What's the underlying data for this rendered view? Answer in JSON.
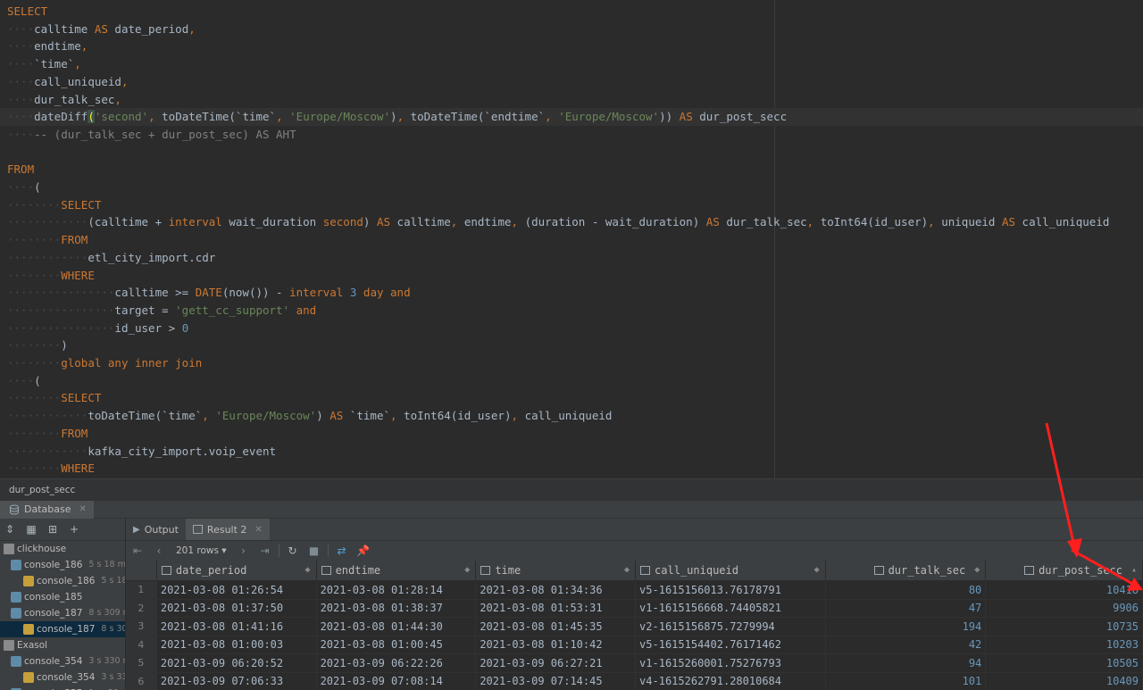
{
  "editor": {
    "lines": [
      [
        {
          "t": "SELECT",
          "c": "kw"
        }
      ],
      [
        {
          "t": "····",
          "c": "ws"
        },
        {
          "t": "calltime "
        },
        {
          "t": "AS",
          "c": "kw"
        },
        {
          "t": " date_period"
        },
        {
          "t": ",",
          "c": "kw"
        }
      ],
      [
        {
          "t": "····",
          "c": "ws"
        },
        {
          "t": "endtime"
        },
        {
          "t": ",",
          "c": "kw"
        }
      ],
      [
        {
          "t": "····",
          "c": "ws"
        },
        {
          "t": "`time`"
        },
        {
          "t": ",",
          "c": "kw"
        }
      ],
      [
        {
          "t": "····",
          "c": "ws"
        },
        {
          "t": "call_uniqueid"
        },
        {
          "t": ",",
          "c": "kw"
        }
      ],
      [
        {
          "t": "····",
          "c": "ws"
        },
        {
          "t": "dur_talk_sec"
        },
        {
          "t": ",",
          "c": "kw"
        }
      ],
      [
        {
          "t": "····",
          "c": "ws"
        },
        {
          "t": "dateDiff"
        },
        {
          "t": "(",
          "c": "br"
        },
        {
          "t": "'second'",
          "c": "str"
        },
        {
          "t": ", ",
          "c": "kw"
        },
        {
          "t": "toDateTime(`time`"
        },
        {
          "t": ", ",
          "c": "kw"
        },
        {
          "t": "'Europe/Moscow'",
          "c": "str"
        },
        {
          "t": ")"
        },
        {
          "t": ", ",
          "c": "kw"
        },
        {
          "t": "toDateTime(`endtime`"
        },
        {
          "t": ", ",
          "c": "kw"
        },
        {
          "t": "'Europe/Moscow'",
          "c": "str"
        },
        {
          "t": "))"
        },
        {
          "t": " AS",
          "c": "kw"
        },
        {
          "t": " dur_post_secc"
        }
      ],
      [
        {
          "t": "····",
          "c": "ws"
        },
        {
          "t": "-- (dur_talk_sec + dur_post_sec) AS AHT",
          "c": "cm"
        }
      ],
      [],
      [
        {
          "t": "FROM",
          "c": "kw"
        }
      ],
      [
        {
          "t": "····",
          "c": "ws"
        },
        {
          "t": "("
        }
      ],
      [
        {
          "t": "········",
          "c": "ws"
        },
        {
          "t": "SELECT",
          "c": "kw"
        }
      ],
      [
        {
          "t": "············",
          "c": "ws"
        },
        {
          "t": "(calltime + "
        },
        {
          "t": "interval",
          "c": "kw"
        },
        {
          "t": " wait_duration "
        },
        {
          "t": "second",
          "c": "kw"
        },
        {
          "t": ") "
        },
        {
          "t": "AS",
          "c": "kw"
        },
        {
          "t": " calltime"
        },
        {
          "t": ", ",
          "c": "kw"
        },
        {
          "t": "endtime"
        },
        {
          "t": ", ",
          "c": "kw"
        },
        {
          "t": "(duration - wait_duration) "
        },
        {
          "t": "AS",
          "c": "kw"
        },
        {
          "t": " dur_talk_sec"
        },
        {
          "t": ", ",
          "c": "kw"
        },
        {
          "t": "toInt64(id_user)"
        },
        {
          "t": ", ",
          "c": "kw"
        },
        {
          "t": "uniqueid "
        },
        {
          "t": "AS",
          "c": "kw"
        },
        {
          "t": " call_uniqueid"
        }
      ],
      [
        {
          "t": "········",
          "c": "ws"
        },
        {
          "t": "FROM",
          "c": "kw"
        }
      ],
      [
        {
          "t": "············",
          "c": "ws"
        },
        {
          "t": "etl_city_import.cdr"
        }
      ],
      [
        {
          "t": "········",
          "c": "ws"
        },
        {
          "t": "WHERE",
          "c": "kw"
        }
      ],
      [
        {
          "t": "················",
          "c": "ws"
        },
        {
          "t": "calltime >= "
        },
        {
          "t": "DATE",
          "c": "kw"
        },
        {
          "t": "(now()) - "
        },
        {
          "t": "interval",
          "c": "kw"
        },
        {
          "t": " "
        },
        {
          "t": "3",
          "c": "num"
        },
        {
          "t": " "
        },
        {
          "t": "day",
          "c": "kw"
        },
        {
          "t": " "
        },
        {
          "t": "and",
          "c": "kw"
        }
      ],
      [
        {
          "t": "················",
          "c": "ws"
        },
        {
          "t": "target = "
        },
        {
          "t": "'gett_cc_support'",
          "c": "str"
        },
        {
          "t": " "
        },
        {
          "t": "and",
          "c": "kw"
        }
      ],
      [
        {
          "t": "················",
          "c": "ws"
        },
        {
          "t": "id_user > "
        },
        {
          "t": "0",
          "c": "num"
        }
      ],
      [
        {
          "t": "········",
          "c": "ws"
        },
        {
          "t": ")"
        }
      ],
      [
        {
          "t": "········",
          "c": "ws"
        },
        {
          "t": "global any inner join",
          "c": "kw"
        }
      ],
      [
        {
          "t": "····",
          "c": "ws"
        },
        {
          "t": "("
        }
      ],
      [
        {
          "t": "········",
          "c": "ws"
        },
        {
          "t": "SELECT",
          "c": "kw"
        }
      ],
      [
        {
          "t": "············",
          "c": "ws"
        },
        {
          "t": "toDateTime(`time`"
        },
        {
          "t": ", ",
          "c": "kw"
        },
        {
          "t": "'Europe/Moscow'",
          "c": "str"
        },
        {
          "t": ") "
        },
        {
          "t": "AS",
          "c": "kw"
        },
        {
          "t": " `time`"
        },
        {
          "t": ", ",
          "c": "kw"
        },
        {
          "t": "toInt64(id_user)"
        },
        {
          "t": ", ",
          "c": "kw"
        },
        {
          "t": "call_uniqueid"
        }
      ],
      [
        {
          "t": "········",
          "c": "ws"
        },
        {
          "t": "FROM",
          "c": "kw"
        }
      ],
      [
        {
          "t": "············",
          "c": "ws"
        },
        {
          "t": "kafka_city_import.voip_event"
        }
      ],
      [
        {
          "t": "········",
          "c": "ws"
        },
        {
          "t": "WHERE",
          "c": "kw"
        }
      ]
    ]
  },
  "breadcrumb": {
    "text": "dur_post_secc"
  },
  "db_panel": {
    "tab_label": "Database"
  },
  "sidebar": {
    "items": [
      {
        "label": "clickhouse",
        "meta": "",
        "icon": "folder-icon"
      },
      {
        "label": "console_186",
        "meta": "5 s 18 ms",
        "icon": "console-icon"
      },
      {
        "label": "console_186",
        "meta": "5 s 18 m",
        "icon": "sql-console-icon"
      },
      {
        "label": "console_185",
        "meta": "",
        "icon": "console-icon"
      },
      {
        "label": "console_187",
        "meta": "8 s 309 ms",
        "icon": "console-icon"
      },
      {
        "label": "console_187",
        "meta": "8 s 309 r",
        "icon": "sql-console-icon"
      },
      {
        "label": "Exasol",
        "meta": "",
        "icon": "folder-icon"
      },
      {
        "label": "console_354",
        "meta": "3 s 330 ms",
        "icon": "console-icon"
      },
      {
        "label": "console_354",
        "meta": "3 s 330 r",
        "icon": "sql-console-icon"
      },
      {
        "label": "console_355",
        "meta": "1 m 59 s 12",
        "icon": "console-icon"
      }
    ]
  },
  "results": {
    "tabs": [
      {
        "label": "Output",
        "icon": "output-icon"
      },
      {
        "label": "Result 2",
        "icon": "table-icon"
      }
    ],
    "rows_label": "201 rows",
    "columns": [
      "date_period",
      "endtime",
      "time",
      "call_uniqueid",
      "dur_talk_sec",
      "dur_post_secc"
    ],
    "rows": [
      [
        "1",
        "2021-03-08 01:26:54",
        "2021-03-08 01:28:14",
        "2021-03-08 01:34:36",
        "v5-1615156013.76178791",
        "80",
        "10418"
      ],
      [
        "2",
        "2021-03-08 01:37:50",
        "2021-03-08 01:38:37",
        "2021-03-08 01:53:31",
        "v1-1615156668.74405821",
        "47",
        "9906"
      ],
      [
        "3",
        "2021-03-08 01:41:16",
        "2021-03-08 01:44:30",
        "2021-03-08 01:45:35",
        "v2-1615156875.7279994",
        "194",
        "10735"
      ],
      [
        "4",
        "2021-03-08 01:00:03",
        "2021-03-08 01:00:45",
        "2021-03-08 01:10:42",
        "v5-1615154402.76171462",
        "42",
        "10203"
      ],
      [
        "5",
        "2021-03-09 06:20:52",
        "2021-03-09 06:22:26",
        "2021-03-09 06:27:21",
        "v1-1615260001.75276793",
        "94",
        "10505"
      ],
      [
        "6",
        "2021-03-09 07:06:33",
        "2021-03-09 07:08:14",
        "2021-03-09 07:14:45",
        "v4-1615262791.28010684",
        "101",
        "10409"
      ]
    ]
  },
  "colors": {
    "arrow": "#ff1f1f",
    "keyword": "#cc7832",
    "string": "#6a8759"
  }
}
